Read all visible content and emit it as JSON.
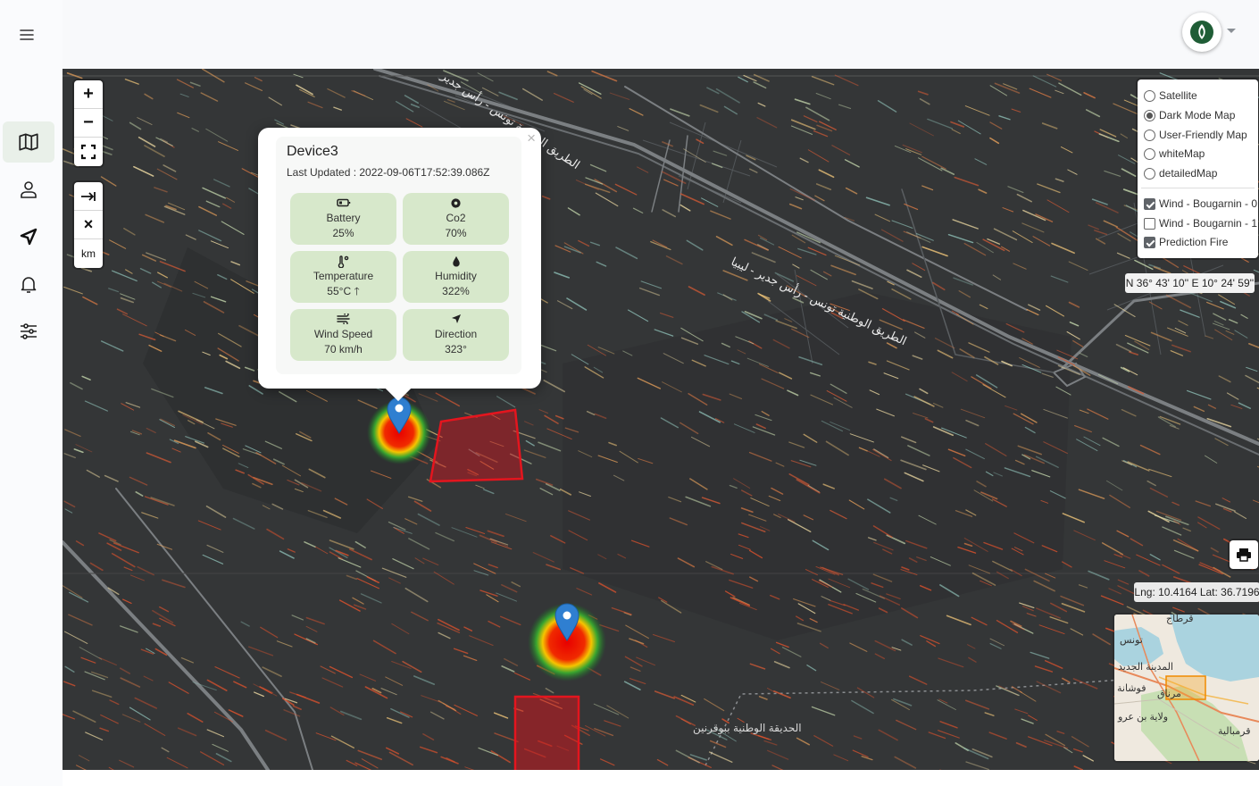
{
  "sidebar": {
    "items": [
      {
        "icon": "map-icon",
        "active": true
      },
      {
        "icon": "user-icon",
        "active": false
      },
      {
        "icon": "send-icon",
        "active": false
      },
      {
        "icon": "bell-icon",
        "active": false
      },
      {
        "icon": "sliders-icon",
        "active": false
      }
    ]
  },
  "map_controls": {
    "zoom_in": "+",
    "zoom_out": "−",
    "measure_close": "×",
    "unit": "km"
  },
  "popup": {
    "device_name": "Device3",
    "last_updated": "Last Updated : 2022-09-06T17:52:39.086Z",
    "close": "×",
    "tiles": [
      {
        "label": "Battery",
        "value": "25%",
        "icon": "battery-icon"
      },
      {
        "label": "Co2",
        "value": "70%",
        "icon": "co2-gear-icon"
      },
      {
        "label": "Temperature",
        "value": "55°C 🡑",
        "icon": "thermometer-icon"
      },
      {
        "label": "Humidity",
        "value": "322%",
        "icon": "droplet-icon"
      },
      {
        "label": "Wind Speed",
        "value": "70 km/h",
        "icon": "wind-icon"
      },
      {
        "label": "Direction",
        "value": "323°",
        "icon": "direction-arrow-icon"
      }
    ]
  },
  "layers": {
    "base_layers": [
      {
        "label": "Satellite",
        "selected": false
      },
      {
        "label": "Dark Mode Map",
        "selected": true
      },
      {
        "label": "User-Friendly Map",
        "selected": false
      },
      {
        "label": "whiteMap",
        "selected": false
      },
      {
        "label": "detailedMap",
        "selected": false
      }
    ],
    "overlays": [
      {
        "label": "Wind - Bougarnin - 0",
        "checked": true
      },
      {
        "label": "Wind - Bougarnin - 1",
        "checked": false
      },
      {
        "label": "Prediction Fire",
        "checked": true
      }
    ]
  },
  "coordinates_dms": "N 36° 43' 10'' E 10° 24' 59''",
  "cursor_position": "Lng: 10.4164 Lat: 36.7196",
  "map_labels": {
    "road_1": "الطريق الوطنية تونس - رأس جدير - ليبيا",
    "road_2": "الطريق الوطنية تونس - رأس جدير",
    "park": "الحديقة الوطنية ببوقرنين"
  },
  "minimap_labels": {
    "label_1": "تونس",
    "label_2": "المدينة الجديد",
    "label_3": "مرناق",
    "label_4": "ولاية بن عرو",
    "label_5": "قرمبالية",
    "label_6": "فوشانة",
    "label_7": "قرطاج"
  },
  "colors": {
    "accent_green": "#d7e8cb",
    "map_background": "#333537",
    "fire_polygon": "#e0141e",
    "marker_blue": "#2f7fd1"
  }
}
